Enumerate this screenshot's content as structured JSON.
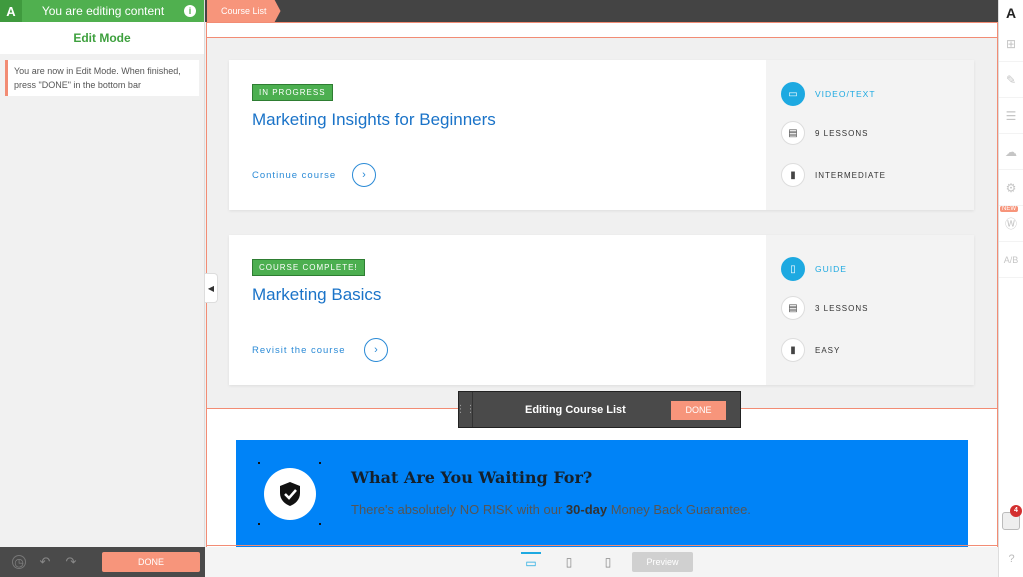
{
  "sidebar": {
    "top_title": "You are editing content",
    "logo": "A",
    "info_icon": "i",
    "mode_title": "Edit Mode",
    "note": "You are now in Edit Mode. When finished, press \"DONE\" in the bottom bar",
    "done_label": "DONE",
    "icons": [
      "history-icon",
      "undo-icon",
      "redo-icon"
    ]
  },
  "topbar": {
    "breadcrumb": "Course List"
  },
  "right_toolbar": {
    "logo": "A",
    "new_badge": "NEW",
    "ab_label": "A/B",
    "notification_count": "4",
    "help": "?"
  },
  "courses": [
    {
      "status": "IN PROGRESS",
      "title": "Marketing Insights for Beginners",
      "link": "Continue course",
      "type": "VIDEO/TEXT",
      "lessons": "9 LESSONS",
      "level": "INTERMEDIATE"
    },
    {
      "status": "COURSE COMPLETE!",
      "title": "Marketing Basics",
      "link": "Revisit the course",
      "type": "GUIDE",
      "lessons": "3 LESSONS",
      "level": "EASY"
    }
  ],
  "cta": {
    "heading": "What Are You Waiting For?",
    "text_pre": "There's absolutely NO RISK with our ",
    "text_bold": "30-day",
    "text_post": " Money Back Guarantee."
  },
  "edit_bar": {
    "title": "Editing Course List",
    "done_label": "DONE"
  },
  "bottom_bar": {
    "preview_label": "Preview"
  },
  "colors": {
    "accent": "#1da9e1",
    "green": "#50b04f",
    "salmon": "#f7957b",
    "cta_blue": "#0083f7"
  }
}
